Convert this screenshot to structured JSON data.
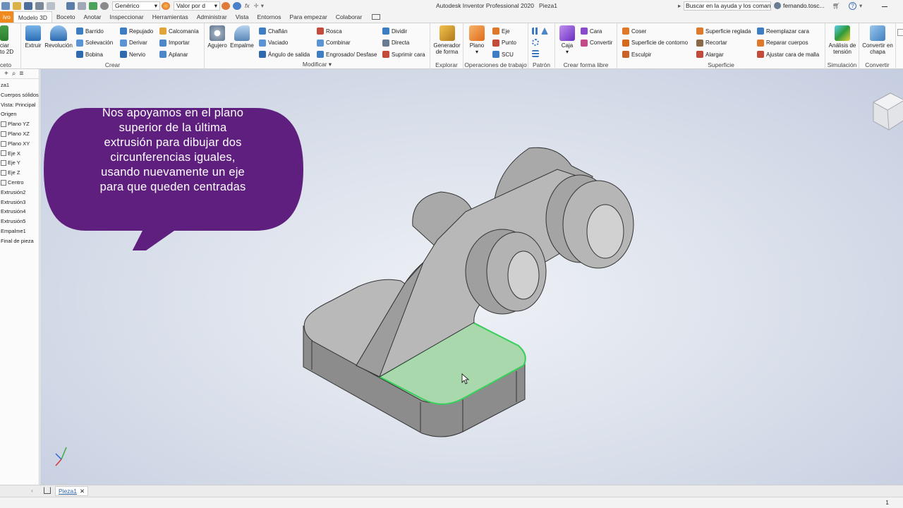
{
  "quick_access": {
    "appearance_select": "Genérico",
    "value_select": "Valor por d"
  },
  "title_bar": {
    "title": "Autodesk Inventor Professional 2020",
    "document": "Pieza1",
    "search_placeholder": "Buscar en la ayuda y los comand",
    "user": "fernando.tosc..."
  },
  "menu_tabs": [
    "Archivo",
    "Modelo 3D",
    "Boceto",
    "Anotar",
    "Inspeccionar",
    "Herramientas",
    "Administrar",
    "Vista",
    "Entornos",
    "Para empezar",
    "Colaborar"
  ],
  "menu_tabs_visible": [
    "ivo",
    "Modelo 3D",
    "Boceto",
    "Anotar",
    "Inspeccionar",
    "Herramientas",
    "Administrar",
    "Vista",
    "Entornos",
    "Para empezar",
    "Colaborar"
  ],
  "ribbon": {
    "sketch_group": {
      "btn": "ciar\nto 2D",
      "label": "ceto"
    },
    "create": {
      "label": "Crear",
      "big": [
        "Extruir",
        "Revolución"
      ],
      "col1": [
        "Barrido",
        "Solevación",
        "Bobina"
      ],
      "col2": [
        "Repujado",
        "Derivar",
        "Nervio"
      ],
      "col3": [
        "Calcomanía",
        "Importar",
        "Aplanar"
      ]
    },
    "modify": {
      "label": "Modificar",
      "big": [
        "Agujero",
        "Empalme"
      ],
      "col1": [
        "Chaflán",
        "Vaciado",
        "Ángulo de salida"
      ],
      "col2": [
        "Rosca",
        "Combinar",
        "Engrosado/ Desfase"
      ],
      "col3": [
        "Dividir",
        "Directa",
        "Suprimir cara"
      ]
    },
    "explore": {
      "label": "Explorar",
      "btn": "Generador de forma"
    },
    "work": {
      "label": "Operaciones de trabajo",
      "big": "Plano",
      "col1": [
        "Eje",
        "Punto",
        "SCU"
      ]
    },
    "pattern": {
      "label": "Patrón"
    },
    "freeform": {
      "label": "Crear forma libre",
      "big": "Caja",
      "col1": [
        "Cara",
        "Convertir"
      ]
    },
    "surface": {
      "label": "Superficie",
      "col1": [
        "Coser",
        "Superficie de contorno",
        "Esculpir"
      ],
      "col2": [
        "Superficie reglada",
        "Recortar",
        "Alargar"
      ],
      "col3": [
        "Reemplazar cara",
        "Reparar cuerpos",
        "Ajustar cara de malla"
      ]
    },
    "simulation": {
      "label": "Simulación",
      "btn": "Análisis de tensión"
    },
    "convert": {
      "label": "Convertir",
      "btn": "Convertir en chapa"
    }
  },
  "browser_tree": [
    "za1",
    "Cuerpos sólidos(",
    "Vista: Principal",
    "Origen",
    "Plano YZ",
    "Plano XZ",
    "Plano XY",
    "Eje X",
    "Eje Y",
    "Eje Z",
    "Centro",
    "Extrusión2",
    "Extrusión3",
    "Extrusión4",
    "Extrusión5",
    "Empalme1",
    "Final de pieza"
  ],
  "callout": {
    "text_lines": [
      "Nos apoyamos en el plano",
      "superior de la última",
      "extrusión para dibujar dos",
      "circunferencias iguales,",
      "usando nuevamente un eje",
      "para que queden centradas"
    ],
    "color": "#5f1f7f"
  },
  "bottom_tab": "Pieza1",
  "status_right": "1",
  "accent": {
    "selection": "#37d05a",
    "orange": "#f08a1c"
  }
}
